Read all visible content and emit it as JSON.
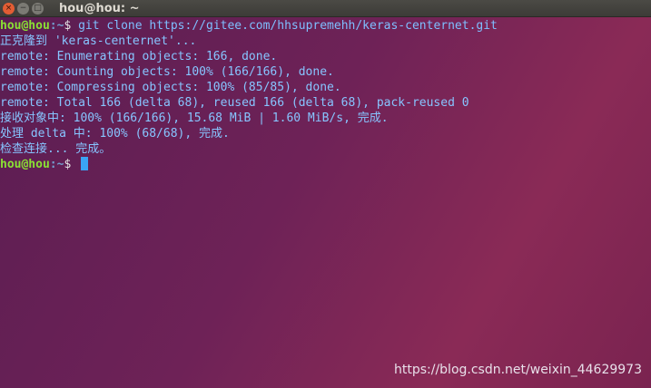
{
  "window": {
    "title": "hou@hou: ~",
    "close_label": "×",
    "minimize_label": "−",
    "maximize_label": "□"
  },
  "terminal": {
    "prompt_user": "hou@hou",
    "prompt_path": ":~",
    "prompt_sign": "$ ",
    "command": "git clone https://gitee.com/hhsupremehh/keras-centernet.git",
    "output": [
      "正克隆到 'keras-centernet'...",
      "remote: Enumerating objects: 166, done.",
      "remote: Counting objects: 100% (166/166), done.",
      "remote: Compressing objects: 100% (85/85), done.",
      "remote: Total 166 (delta 68), reused 166 (delta 68), pack-reused 0",
      "接收对象中: 100% (166/166), 15.68 MiB | 1.60 MiB/s, 完成.",
      "处理 delta 中: 100% (68/68), 完成.",
      "检查连接... 完成。"
    ]
  },
  "watermark": "https://blog.csdn.net/weixin_44629973"
}
